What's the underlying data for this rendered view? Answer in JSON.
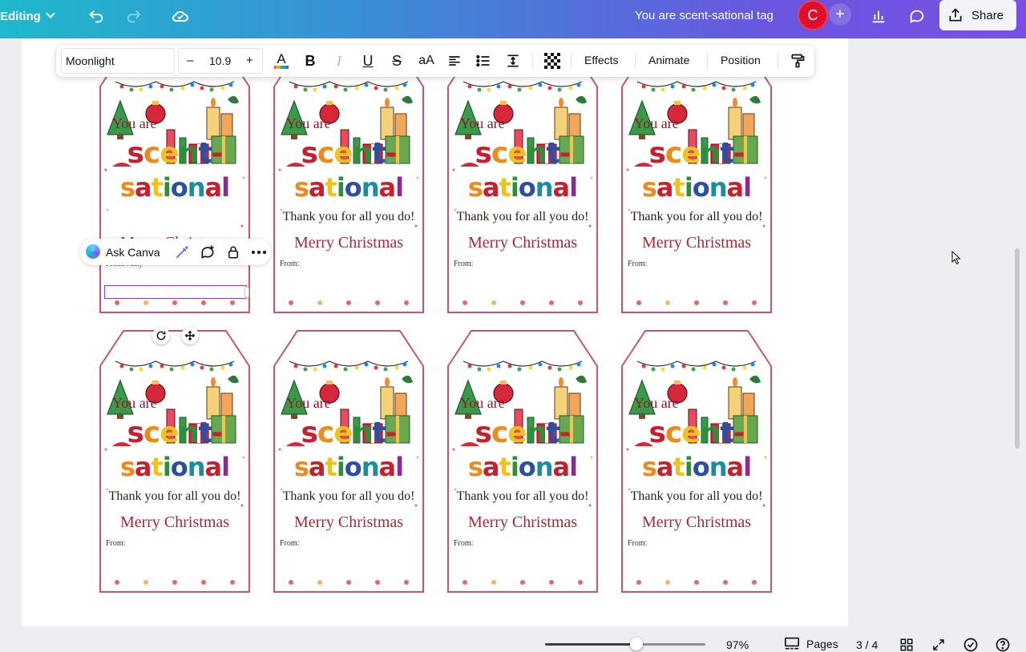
{
  "topbar": {
    "mode_label": "Editing",
    "title": "You are scent-sational tag",
    "avatar_initial": "C",
    "share_label": "Share"
  },
  "toolbar": {
    "font_name": "Moonlight",
    "font_size": "10.9",
    "minus": "–",
    "plus": "+",
    "bold": "B",
    "italic": "I",
    "underline": "U",
    "strike": "S",
    "case": "aA",
    "color_letter": "A",
    "effects_label": "Effects",
    "animate_label": "Animate",
    "position_label": "Position"
  },
  "ask_canva": {
    "label": "Ask Canva"
  },
  "tag_text": {
    "you_are": "You are",
    "scent": [
      "s",
      "c",
      "e",
      "n",
      "t",
      "-"
    ],
    "sational": [
      "s",
      "a",
      "t",
      "i",
      "o",
      "n",
      "a",
      "l"
    ],
    "thanks": "Thank you for all you do!",
    "merry": "Merry Christmas"
  },
  "tags": [
    {
      "from": "From: Amy",
      "show_thanks": false
    },
    {
      "from": "From:",
      "show_thanks": true
    },
    {
      "from": "From:",
      "show_thanks": true
    },
    {
      "from": "From:",
      "show_thanks": true
    },
    {
      "from": "From:",
      "show_thanks": true
    },
    {
      "from": "From:",
      "show_thanks": true
    },
    {
      "from": "From:",
      "show_thanks": true
    },
    {
      "from": "From:",
      "show_thanks": true
    }
  ],
  "bottombar": {
    "zoom": "97%",
    "zoom_fraction": 0.57,
    "pages_label": "Pages",
    "page_count": "3 / 4"
  },
  "colors": {
    "brand_gradient_start": "#1fb8cc",
    "brand_gradient_end": "#7a4fe4",
    "avatar": "#e0102b",
    "tag_border": "#c45472",
    "selection": "#8b3dff"
  },
  "icons": [
    "chevron-down-icon",
    "undo-icon",
    "redo-icon",
    "cloud-saved-icon",
    "insights-icon",
    "comment-icon",
    "share-icon",
    "text-color-icon",
    "align-icon",
    "list-icon",
    "spacing-icon",
    "transparency-icon",
    "paint-roller-icon",
    "magic-edit-icon",
    "comment-add-icon",
    "lock-icon",
    "more-icon",
    "rotate-icon",
    "move-icon",
    "pages-icon",
    "grid-view-icon",
    "fullscreen-icon",
    "check-circle-icon",
    "help-icon"
  ]
}
